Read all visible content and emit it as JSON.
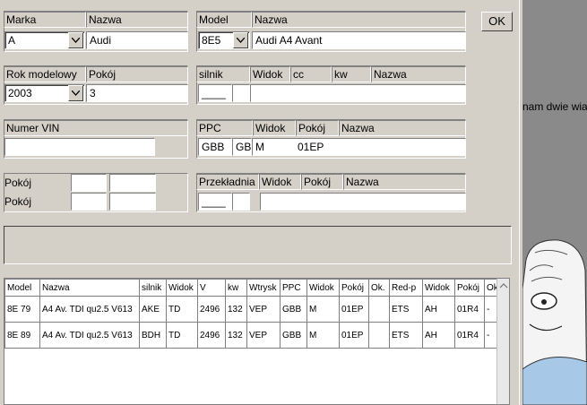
{
  "marka": {
    "header": "Marka",
    "value": "A"
  },
  "marka_nazwa": {
    "header": "Nazwa",
    "value": "Audi"
  },
  "model": {
    "header": "Model",
    "value": "8E5"
  },
  "model_nazwa": {
    "header": "Nazwa",
    "value": "Audi A4 Avant"
  },
  "ok_button": "OK",
  "rok": {
    "header": "Rok modelowy",
    "value": "2003"
  },
  "rok_pokoj": {
    "header": "Pokój",
    "value": "3"
  },
  "silnik": {
    "header": "silnik",
    "col2": "Widok",
    "col3": "cc",
    "col4": "kw",
    "col5": "Nazwa",
    "value": "____"
  },
  "vin": {
    "header": "Numer VIN",
    "value": ""
  },
  "ppc": {
    "header": "PPC",
    "col2": "Widok",
    "col3": "Pokój",
    "col4": "Nazwa",
    "value1": "GBB",
    "value2": "GB",
    "widok": "M",
    "pokoj": "01EP"
  },
  "pokoj_labels": [
    "Pokój",
    "Pokój"
  ],
  "przekladnia": {
    "header": "Przekładnia",
    "col2": "Widok",
    "col3": "Pokój",
    "col4": "Nazwa",
    "value": "____"
  },
  "table": {
    "headers": [
      "Model",
      "Nazwa",
      "silnik",
      "Widok",
      "V",
      "kw",
      "Wtrysk",
      "PPC",
      "Widok",
      "Pokój",
      "Ok.",
      "Red-p",
      "Widok",
      "Pokój",
      "Ok."
    ],
    "rows": [
      [
        "8E 79",
        "A4 Av. TDI qu2.5 V613",
        "AKE",
        "TD",
        "2496",
        "132",
        "VEP",
        "GBB",
        "M",
        "01EP",
        "",
        "ETS",
        "AH",
        "01R4",
        "-"
      ],
      [
        "8E 89",
        "A4 Av. TDI qu2.5 V613",
        "BDH",
        "TD",
        "2496",
        "132",
        "VEP",
        "GBB",
        "M",
        "01EP",
        "",
        "ETS",
        "AH",
        "01R4",
        "-"
      ]
    ]
  },
  "side_text": "nam dwie wia"
}
